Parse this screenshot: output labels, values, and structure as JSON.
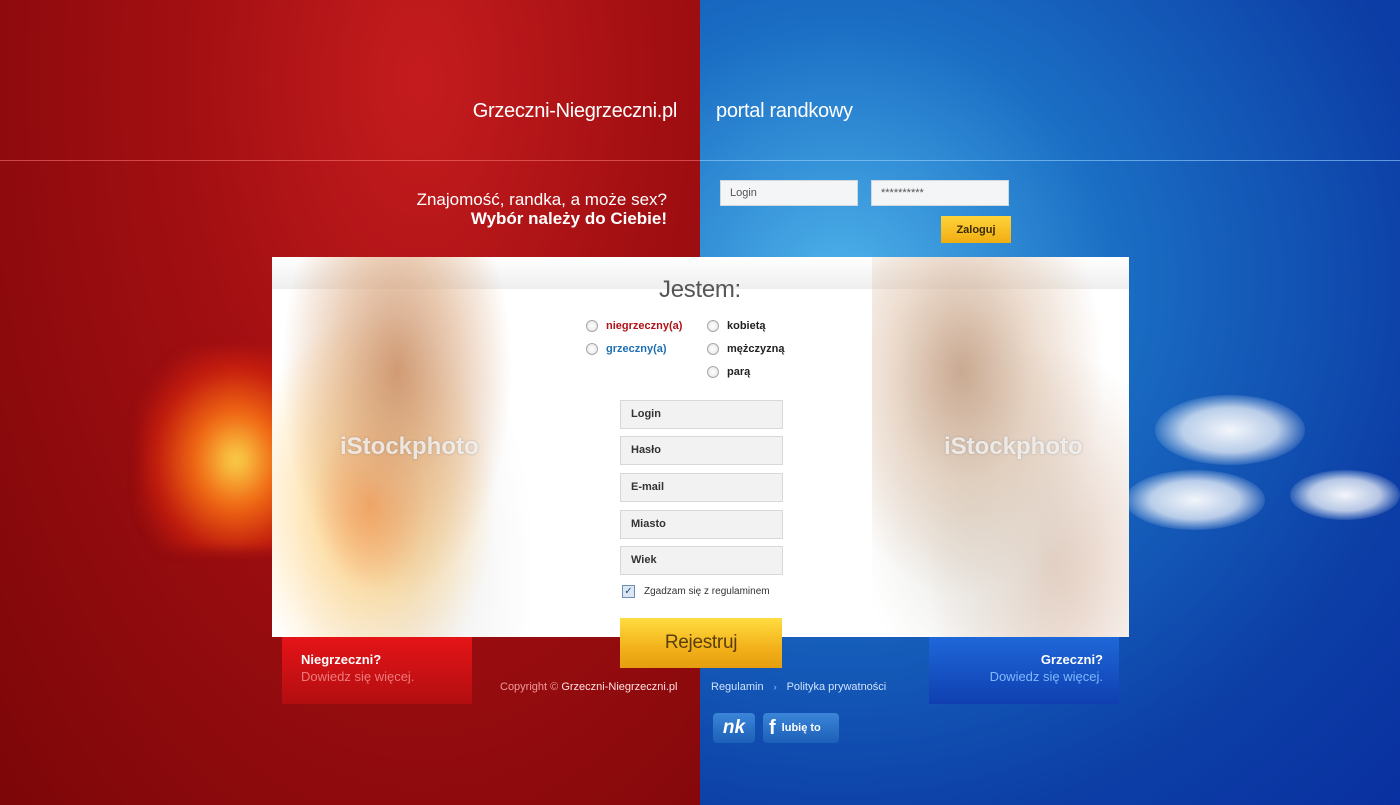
{
  "header": {
    "site_title": "Grzeczni-Niegrzeczni.pl",
    "subtitle": "portal randkowy"
  },
  "tagline": {
    "line1": "Znajomość, randka, a może sex?",
    "line2": "Wybór należy do Ciebie!"
  },
  "login_form": {
    "login_value": "Login",
    "password_value": "**********",
    "submit_label": "Zaloguj"
  },
  "registration": {
    "heading": "Jestem:",
    "type_options": [
      "niegrzeczny(a)",
      "grzeczny(a)"
    ],
    "gender_options": [
      "kobietą",
      "mężczyzną",
      "parą"
    ],
    "fields": {
      "login": "Login",
      "password": "Hasło",
      "email": "E-mail",
      "city": "Miasto",
      "age": "Wiek"
    },
    "terms_label": "Zgadzam się z regulaminem",
    "submit_label": "Rejestruj"
  },
  "watermarks": {
    "left": "iStockphoto",
    "right": "iStockphoto"
  },
  "promo": {
    "niegrzeczni": {
      "title": "Niegrzeczni?",
      "link": "Dowiedz się więcej."
    },
    "grzeczni": {
      "title": "Grzeczni?",
      "link": "Dowiedz się więcej."
    }
  },
  "footer": {
    "copyright_prefix": "Copyright ©",
    "copyright_site": "Grzeczni-Niegrzeczni.pl",
    "links": [
      "Regulamin",
      "Polityka prywatności"
    ],
    "link_separator": "›"
  },
  "social": {
    "nk_label": "nk",
    "fb_icon": "f",
    "fb_label": "lubię to"
  },
  "colors": {
    "left_red": "#a20f12",
    "right_blue": "#1a6ec4",
    "accent_yellow": "#f3b11a",
    "niegrzeczny_text": "#b21219",
    "grzeczny_text": "#1e6fb4"
  }
}
